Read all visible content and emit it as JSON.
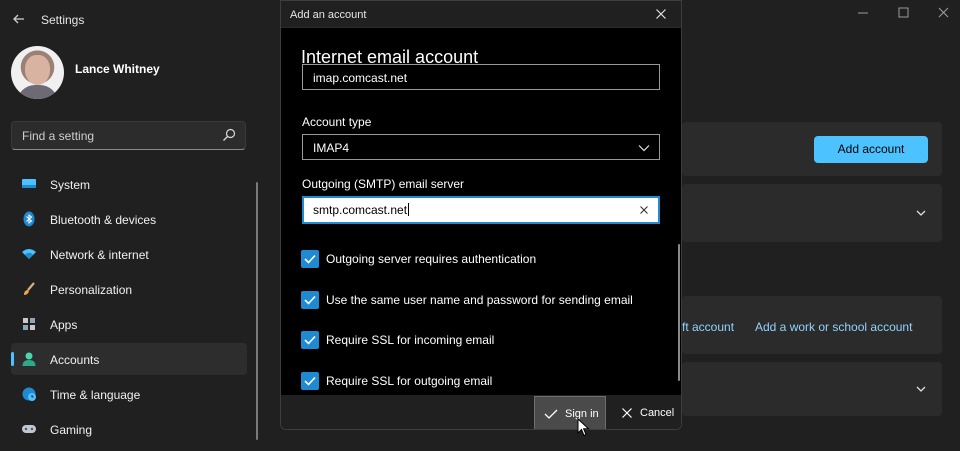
{
  "window": {
    "title": "Settings",
    "back_icon": "back-arrow-icon",
    "controls": [
      "minimize-icon",
      "maximize-icon",
      "close-icon"
    ]
  },
  "profile": {
    "name": "Lance Whitney"
  },
  "search": {
    "placeholder": "Find a setting",
    "icon": "search-icon"
  },
  "nav": [
    {
      "label": "System",
      "icon": "system-icon",
      "active": false
    },
    {
      "label": "Bluetooth & devices",
      "icon": "bluetooth-icon",
      "active": false
    },
    {
      "label": "Network & internet",
      "icon": "wifi-icon",
      "active": false
    },
    {
      "label": "Personalization",
      "icon": "brush-icon",
      "active": false
    },
    {
      "label": "Apps",
      "icon": "apps-icon",
      "active": false
    },
    {
      "label": "Accounts",
      "icon": "accounts-icon",
      "active": true
    },
    {
      "label": "Time & language",
      "icon": "globe-clock-icon",
      "active": false
    },
    {
      "label": "Gaming",
      "icon": "gamepad-icon",
      "active": false
    }
  ],
  "content": {
    "add_account_button": "Add account",
    "link_partial": "ft account",
    "link_work": "Add a work or school account"
  },
  "dialog": {
    "title": "Add an account",
    "heading": "Internet email account",
    "incoming_server_value": "imap.comcast.net",
    "account_type_label": "Account type",
    "account_type_value": "IMAP4",
    "outgoing_label": "Outgoing (SMTP) email server",
    "outgoing_value": "smtp.comcast.net",
    "checkboxes": [
      {
        "label": "Outgoing server requires authentication",
        "checked": true
      },
      {
        "label": "Use the same user name and password for sending email",
        "checked": true
      },
      {
        "label": "Require SSL for incoming email",
        "checked": true
      },
      {
        "label": "Require SSL for outgoing email",
        "checked": true
      }
    ],
    "signin_label": "Sign in",
    "cancel_label": "Cancel"
  },
  "colors": {
    "accent": "#4cc2ff",
    "checkbox": "#1f8ad2",
    "background": "#202020",
    "card": "#2b2b2b",
    "dialog_body": "#000000"
  }
}
